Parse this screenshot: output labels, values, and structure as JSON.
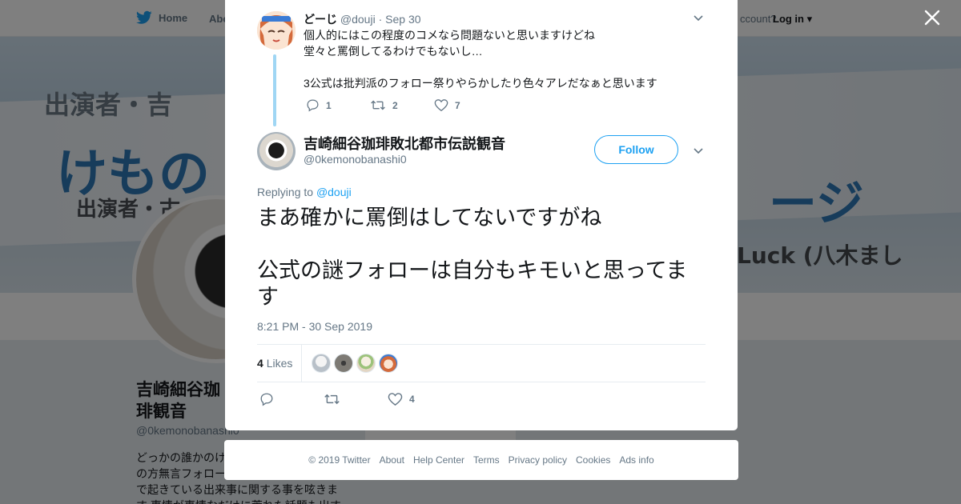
{
  "colors": {
    "accent": "#1da1f2",
    "muted": "#657786",
    "text": "#14171a",
    "thread_line": "#9fd6f4",
    "overlay": "rgba(0,0,0,0.5)"
  },
  "topnav": {
    "home_label": "Home",
    "about_label": "Abo",
    "account_text": "ccount?",
    "login_label": "Log in"
  },
  "banner": {
    "text_top": "出演者・吉",
    "text_main": "けもの",
    "text_sub": "出演者・古",
    "text_right": "ージ",
    "text_right2": "Luck (八木まし"
  },
  "profile": {
    "name": "吉崎細谷珈琲観音",
    "handle": "@0kemonobanashi0",
    "bio": "どっかの誰かのけ\nの方無言フォロー\nで起きている出来事に関する事を呟きま\nす 事情が事情なだけに荒れた話題も出す"
  },
  "modal": {
    "close_icon": "close-icon",
    "reply": {
      "name": "どーじ",
      "handle": "@douji",
      "separator": "·",
      "date": "Sep 30",
      "text": "個人的にはこの程度のコメなら問題ないと思いますけどね\n堂々と罵倒してるわけでもないし…\n\n3公式は批判派のフォロー祭りやらかしたり色々アレだなぁと思います",
      "reply_count": "1",
      "retweet_count": "2",
      "like_count": "7"
    },
    "tweet": {
      "name": "吉崎細谷珈琲敗北都市伝説観音",
      "handle": "@0kemonobanashi0",
      "follow_label": "Follow",
      "replying_prefix": "Replying to",
      "replying_to": "@douji",
      "text": "まあ確かに罵倒はしてないですがね\n\n公式の謎フォローは自分もキモいと思ってます",
      "timestamp": "8:21 PM - 30 Sep 2019",
      "likes_number": "4",
      "likes_label": "Likes",
      "like_count": "4"
    }
  },
  "footer": {
    "links": [
      "© 2019 Twitter",
      "About",
      "Help Center",
      "Terms",
      "Privacy policy",
      "Cookies",
      "Ads info"
    ]
  }
}
